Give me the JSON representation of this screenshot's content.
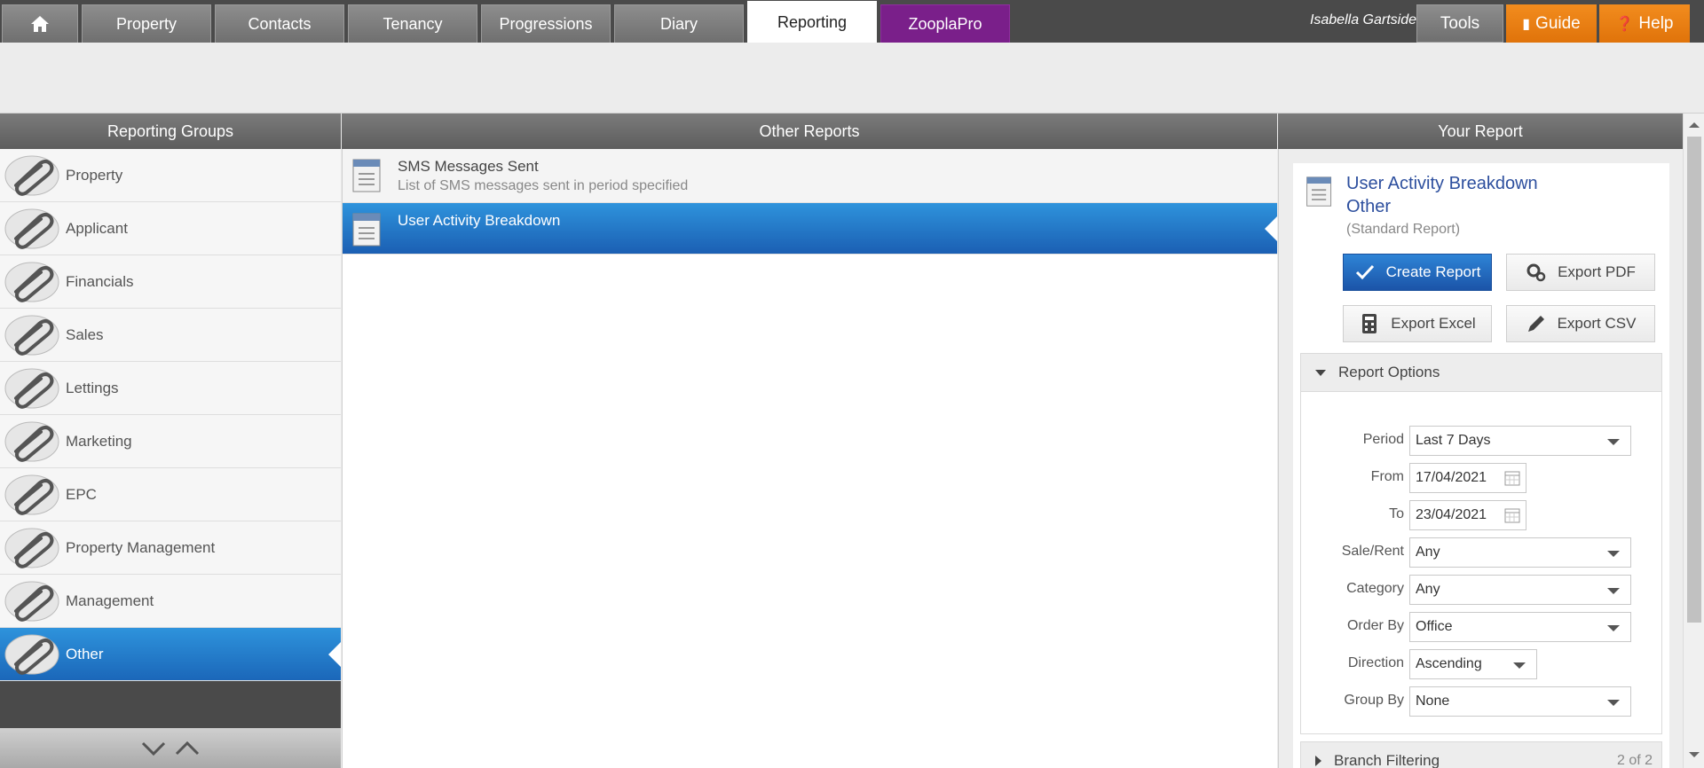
{
  "nav": {
    "tabs": [
      {
        "label": "Property"
      },
      {
        "label": "Contacts"
      },
      {
        "label": "Tenancy"
      },
      {
        "label": "Progressions"
      },
      {
        "label": "Diary"
      },
      {
        "label": "Reporting"
      },
      {
        "label": "ZooplaPro"
      }
    ],
    "active_tab": "Reporting",
    "user_name": "Isabella Gartside",
    "tools_label": "Tools",
    "guide_label": "Guide",
    "help_label": "Help",
    "accent_orange": "#e8800f",
    "zoopla_purple": "#7a1f8a"
  },
  "left_panel": {
    "title": "Reporting Groups",
    "groups": [
      {
        "label": "Property"
      },
      {
        "label": "Applicant"
      },
      {
        "label": "Financials"
      },
      {
        "label": "Sales"
      },
      {
        "label": "Lettings"
      },
      {
        "label": "Marketing"
      },
      {
        "label": "EPC"
      },
      {
        "label": "Property Management"
      },
      {
        "label": "Management"
      },
      {
        "label": "Other"
      }
    ],
    "selected_group": "Other"
  },
  "center_panel": {
    "title": "Other Reports",
    "reports": [
      {
        "title": "SMS Messages Sent",
        "description": "List of SMS messages sent in period specified"
      },
      {
        "title": "User Activity Breakdown",
        "description": ""
      }
    ],
    "selected_report": "User Activity Breakdown"
  },
  "right_panel": {
    "title": "Your Report",
    "report_name": "User Activity Breakdown",
    "report_group": "Other",
    "report_type": "(Standard Report)",
    "buttons": {
      "create": "Create Report",
      "export_pdf": "Export PDF",
      "export_excel": "Export Excel",
      "export_csv": "Export CSV"
    },
    "options_title": "Report Options",
    "options": {
      "period": {
        "label": "Period",
        "value": "Last 7 Days"
      },
      "from": {
        "label": "From",
        "value": "17/04/2021"
      },
      "to": {
        "label": "To",
        "value": "23/04/2021"
      },
      "sale_rent": {
        "label": "Sale/Rent",
        "value": "Any"
      },
      "category": {
        "label": "Category",
        "value": "Any"
      },
      "order_by": {
        "label": "Order By",
        "value": "Office"
      },
      "direction": {
        "label": "Direction",
        "value": "Ascending"
      },
      "group_by": {
        "label": "Group By",
        "value": "None"
      }
    },
    "branch_filtering": {
      "title": "Branch Filtering",
      "count": "2 of 2"
    }
  },
  "colors": {
    "selection_blue": "#1f6fc2",
    "primary_button": "#1b54a8",
    "link_blue": "#2d4f9e"
  }
}
